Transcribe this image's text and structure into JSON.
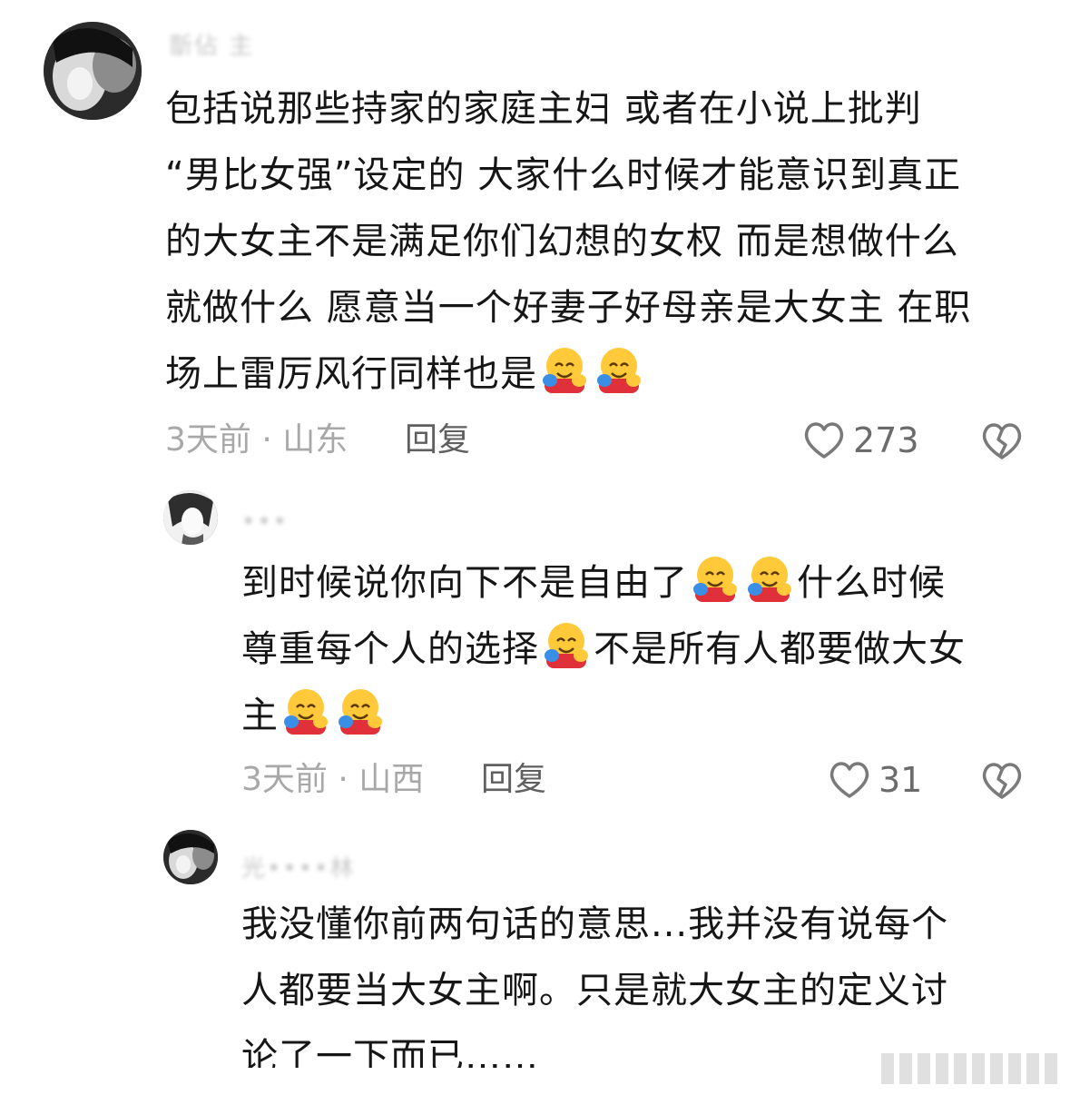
{
  "comments": [
    {
      "username": "斮佔 主",
      "text_lines": [
        "包括说那些持家的家庭主妇 或者在小说上批判",
        "“男比女强”设定的 大家什么时候才能意识到真正",
        "的大女主不是满足你们幻想的女权 而是想做什么",
        "就做什么 愿意当一个好妻子好母亲是大女主 在职",
        "场上雷厉风行同样也是"
      ],
      "time_location": "3天前 · 山东",
      "reply_label": "回复",
      "likes": "273"
    },
    {
      "username": "•••",
      "text_lines": [
        "到时候说你向下不是自由了",
        "什么时候",
        "尊重每个人的选择",
        "不是所有人都要做大女",
        "主"
      ],
      "time_location": "3天前 · 山西",
      "reply_label": "回复",
      "likes": "31"
    },
    {
      "username": "光••••林",
      "text_lines": [
        "我没懂你前两句话的意思...我并没有说每个",
        "人都要当大女主啊。只是就大女主的定义讨",
        "论了一下而已……"
      ]
    }
  ],
  "icons": {
    "like": "heart-outline-icon",
    "dislike": "broken-heart-icon",
    "emoji": "hugging-face-emoji"
  }
}
